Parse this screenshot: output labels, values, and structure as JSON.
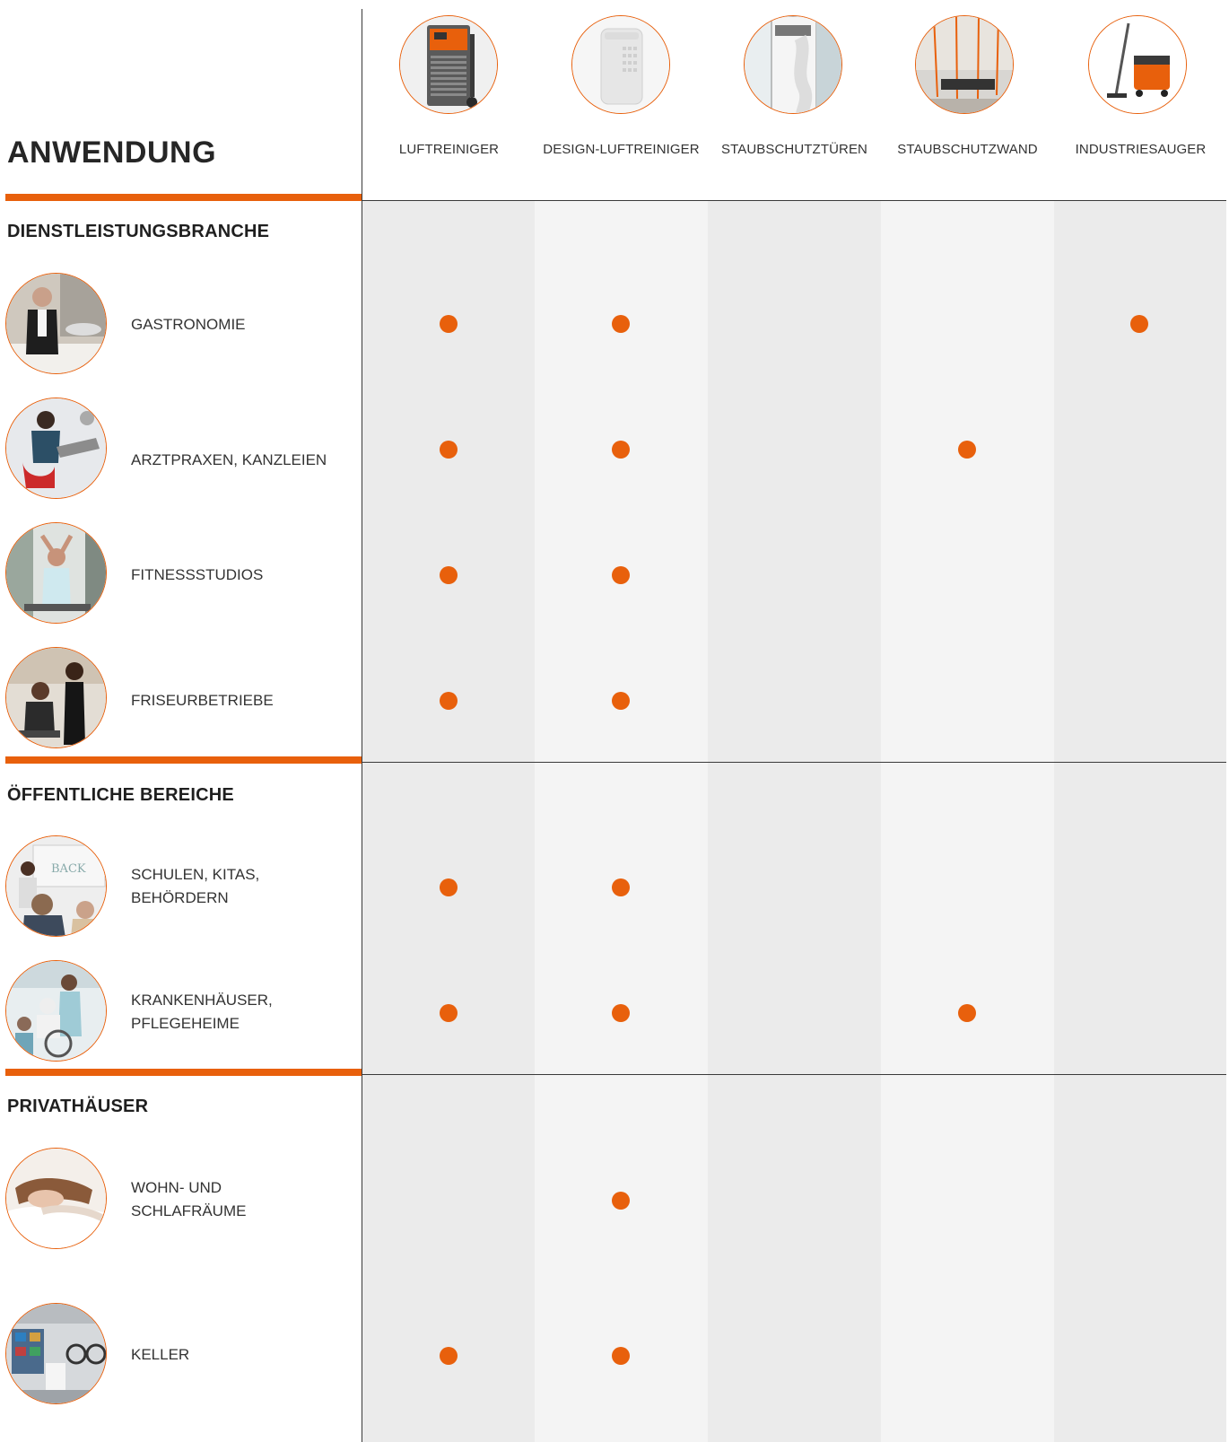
{
  "title": "ANWENDUNG",
  "accent_color": "#e8600c",
  "products": [
    {
      "label": "LUFTREINIGER",
      "icon": "air-purifier-icon"
    },
    {
      "label": "DESIGN-LUFTREINIGER",
      "icon": "design-air-purifier-icon"
    },
    {
      "label": "STAUBSCHUTZTÜREN",
      "icon": "dust-protection-door-icon"
    },
    {
      "label": "STAUBSCHUTZWAND",
      "icon": "dust-protection-wall-icon"
    },
    {
      "label": "INDUSTRIESAUGER",
      "icon": "industrial-vacuum-icon"
    }
  ],
  "sections": [
    {
      "title": "DIENSTLEISTUNGSBRANCHE",
      "rows": [
        {
          "lines": [
            "GASTRONOMIE"
          ],
          "marks": [
            true,
            true,
            false,
            false,
            true
          ]
        },
        {
          "lines": [
            "ARZTPRAXEN, KANZLEIEN"
          ],
          "marks": [
            true,
            true,
            false,
            true,
            false
          ]
        },
        {
          "lines": [
            "FITNESSSTUDIOS"
          ],
          "marks": [
            true,
            true,
            false,
            false,
            false
          ]
        },
        {
          "lines": [
            "FRISEURBETRIEBE"
          ],
          "marks": [
            true,
            true,
            false,
            false,
            false
          ]
        }
      ]
    },
    {
      "title": "ÖFFENTLICHE BEREICHE",
      "rows": [
        {
          "lines": [
            "SCHULEN, KITAS,",
            "BEHÖRDERN"
          ],
          "marks": [
            true,
            true,
            false,
            false,
            false
          ]
        },
        {
          "lines": [
            "KRANKENHÄUSER,",
            "PFLEGEHEIME"
          ],
          "marks": [
            true,
            true,
            false,
            true,
            false
          ]
        }
      ]
    },
    {
      "title": "PRIVATHÄUSER",
      "rows": [
        {
          "lines": [
            "WOHN- UND",
            "SCHLAFRÄUME"
          ],
          "marks": [
            false,
            true,
            false,
            false,
            false
          ]
        },
        {
          "lines": [
            "KELLER"
          ],
          "marks": [
            true,
            true,
            false,
            false,
            false
          ]
        }
      ]
    }
  ]
}
